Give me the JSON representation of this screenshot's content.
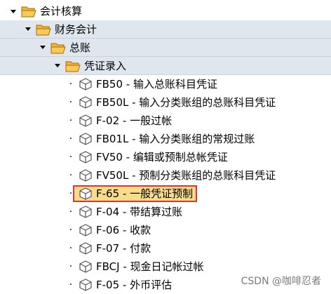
{
  "tree": {
    "root": {
      "label": "会计核算"
    },
    "level1": {
      "label": "财务会计"
    },
    "level2": {
      "label": "总账"
    },
    "level3": {
      "label": "凭证录入"
    },
    "items": [
      {
        "label": "FB50 - 输入总账科目凭证"
      },
      {
        "label": "FB50L - 输入分类账组的总账科目凭证"
      },
      {
        "label": "F-02 - 一般过帐"
      },
      {
        "label": "FB01L - 输入分类账组的常规过账"
      },
      {
        "label": "FV50 - 编辑或预制总帐凭证"
      },
      {
        "label": "FV50L - 预制分类账组的总账科目凭证"
      },
      {
        "label": "F-65 - 一般凭证预制",
        "selected": true
      },
      {
        "label": "F-04 - 带结算过账"
      },
      {
        "label": "F-06 - 收款"
      },
      {
        "label": "F-07 - 付款"
      },
      {
        "label": "FBCJ - 现金日记帐过帐"
      },
      {
        "label": "F-05 - 外币评估"
      }
    ]
  },
  "watermark": "CSDN @咖啡忍者",
  "colors": {
    "folder": "#f0a020",
    "selection_bg": "#f8dc8a",
    "selection_border": "#e0343a",
    "band": "#dfe6ee"
  }
}
